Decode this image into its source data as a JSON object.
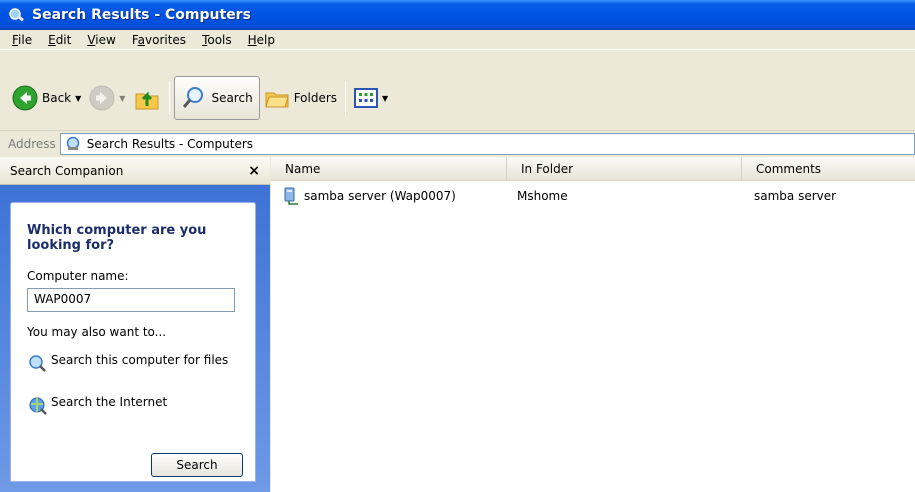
{
  "window": {
    "title": "Search Results - Computers"
  },
  "menu": {
    "items": [
      {
        "label": "File",
        "accel": "F",
        "rest": "ile"
      },
      {
        "label": "Edit",
        "accel": "E",
        "rest": "dit"
      },
      {
        "label": "View",
        "accel": "V",
        "rest": "iew"
      },
      {
        "label": "Favorites",
        "pre": "F",
        "accel": "a",
        "rest": "vorites"
      },
      {
        "label": "Tools",
        "accel": "T",
        "rest": "ools"
      },
      {
        "label": "Help",
        "accel": "H",
        "rest": "elp"
      }
    ]
  },
  "toolbar": {
    "back_label": "Back",
    "search_label": "Search",
    "folders_label": "Folders"
  },
  "address": {
    "label": "Address",
    "value": "Search Results - Computers"
  },
  "companion": {
    "title": "Search Companion",
    "close_glyph": "×",
    "question": "Which computer are you looking for?",
    "field_label": "Computer name:",
    "field_value": "WAP0007",
    "also_text": "You may also want to...",
    "link_computer": "Search this computer for files",
    "link_internet": "Search the Internet",
    "search_button": "Search"
  },
  "results": {
    "columns": [
      "Name",
      "In Folder",
      "Comments"
    ],
    "rows": [
      {
        "name": "samba server (Wap0007)",
        "folder": "Mshome",
        "comments": "samba server"
      }
    ]
  },
  "colors": {
    "titlebar": "#0054e3",
    "pane_gradient_top": "#3e72d6",
    "pane_gradient_bottom": "#6e9ae6",
    "question_text": "#1a2e6b"
  }
}
